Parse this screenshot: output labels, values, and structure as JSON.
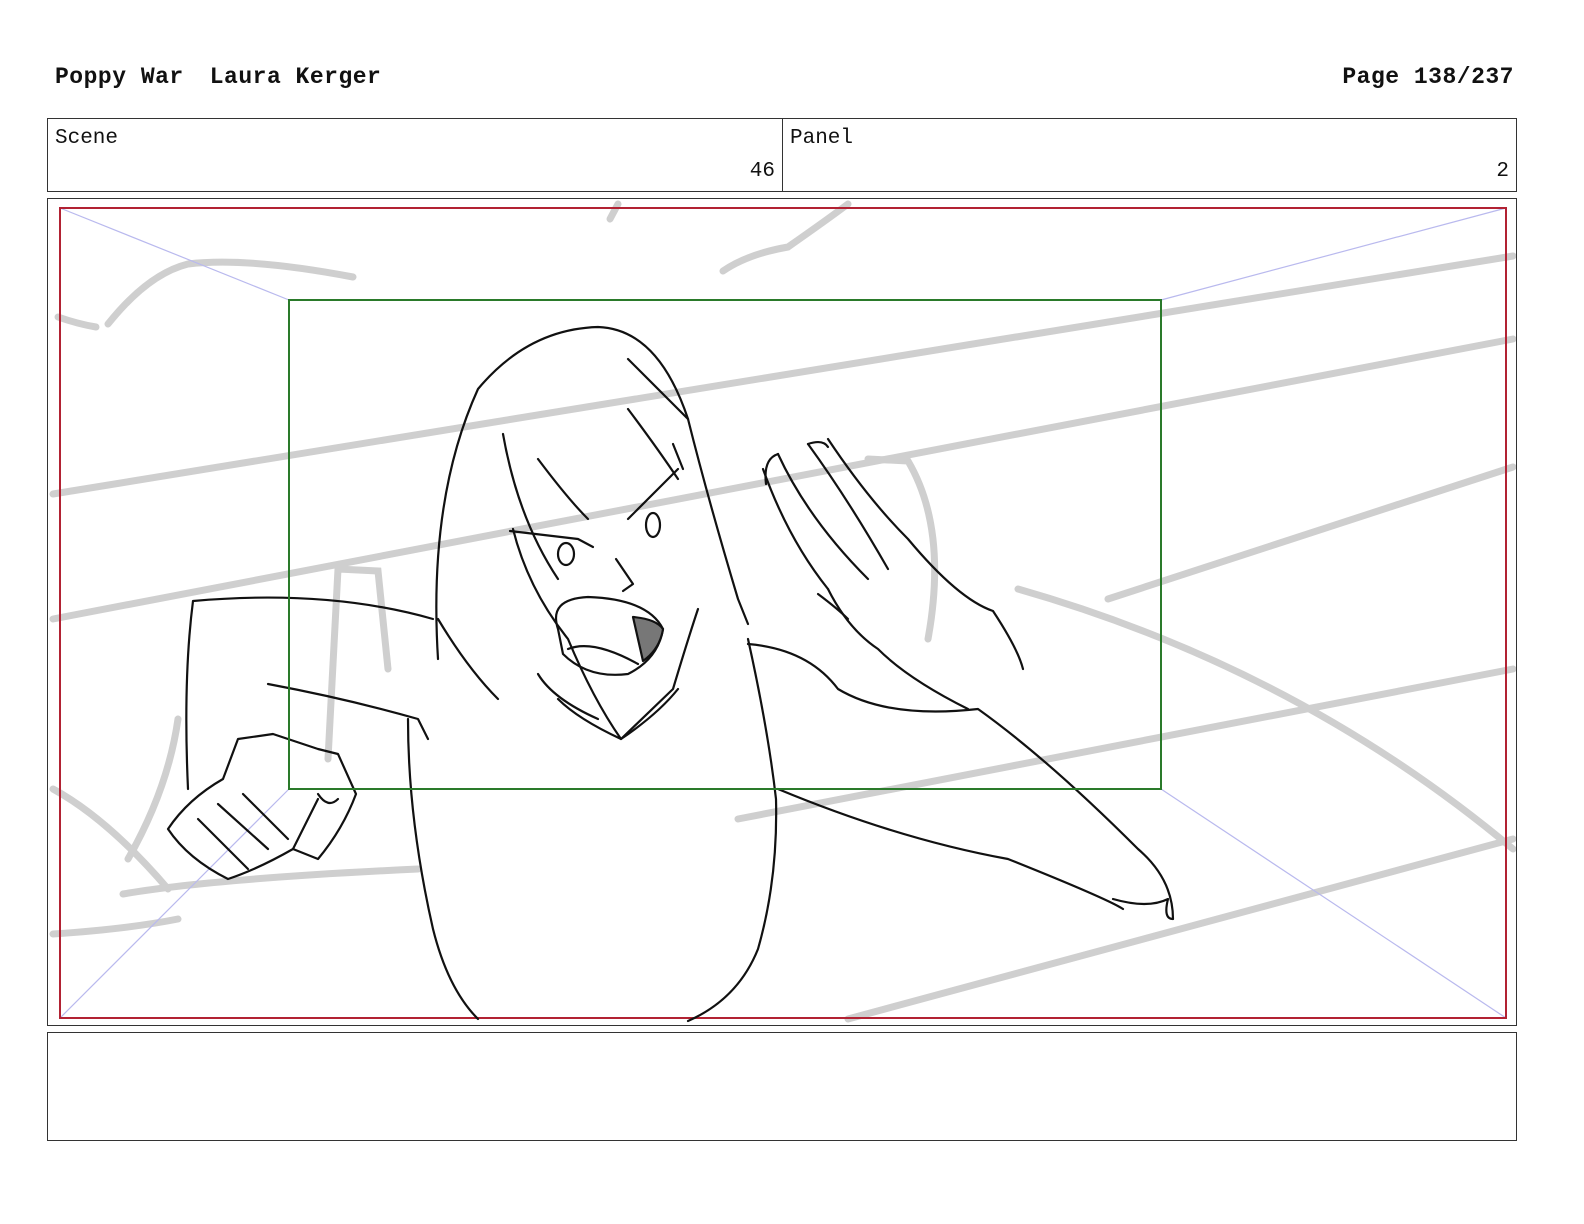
{
  "header": {
    "project": "Poppy War",
    "author": "Laura Kerger",
    "page_label": "Page 138/237"
  },
  "info": {
    "scene_label": "Scene",
    "scene_value": "46",
    "panel_label": "Panel",
    "panel_value": "2"
  },
  "frame": {
    "outer_frame_color": "#b22233",
    "safe_frame_color": "#2a7a2a",
    "guide_line_color": "#b9b9ee",
    "sketch_color": "#111111",
    "background_sketch_color": "#cfcfcf"
  },
  "notes": {
    "text": ""
  }
}
